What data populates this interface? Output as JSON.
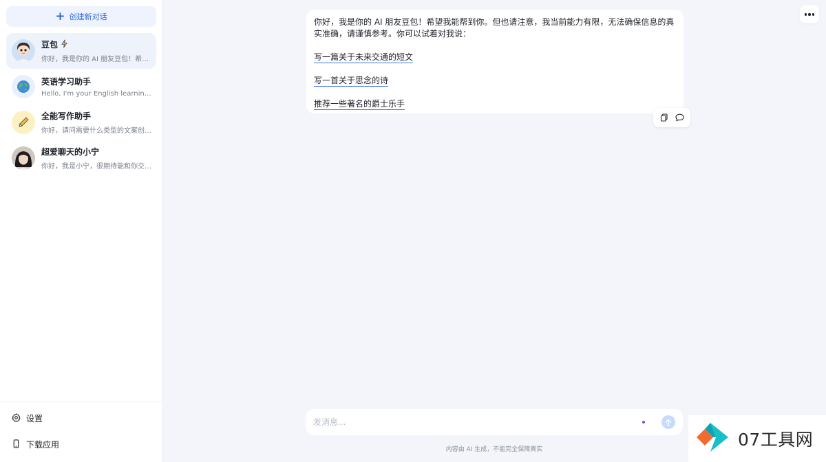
{
  "sidebar": {
    "new_chat_label": "创建新对话",
    "conversations": [
      {
        "title": "豆包",
        "preview": "你好，我是你的 AI 朋友豆包！希望我能帮到你。",
        "badge": "lightning-icon",
        "avatar": "doubao-avatar"
      },
      {
        "title": "英语学习助手",
        "preview": "Hello, I'm your English learning assistant.",
        "avatar": "globe-avatar"
      },
      {
        "title": "全能写作助手",
        "preview": "你好，请问需要什么类型的文案创作？",
        "avatar": "pencil-avatar"
      },
      {
        "title": "超爱聊天的小宁",
        "preview": "你好，我是小宁，很期待能和你交流！",
        "avatar": "girl-avatar"
      }
    ],
    "settings_label": "设置",
    "download_label": "下载应用"
  },
  "chat": {
    "intro": "你好，我是你的 AI 朋友豆包！希望我能帮到你。但也请注意，我当前能力有限，无法确保信息的真实准确，请谨慎参考。你可以试着对我说：",
    "suggestions": [
      "写一篇关于未来交通的短文",
      "写一首关于思念的诗",
      "推荐一些著名的爵士乐手"
    ]
  },
  "composer": {
    "placeholder": "发消息..."
  },
  "footer": {
    "disclaimer": "内容由 AI 生成，不能完全保障真实"
  },
  "watermark": {
    "text": "07工具网"
  },
  "colors": {
    "accent": "#2f6bd8",
    "background": "#f3f5fb",
    "send_button": "#c9dbfb"
  }
}
